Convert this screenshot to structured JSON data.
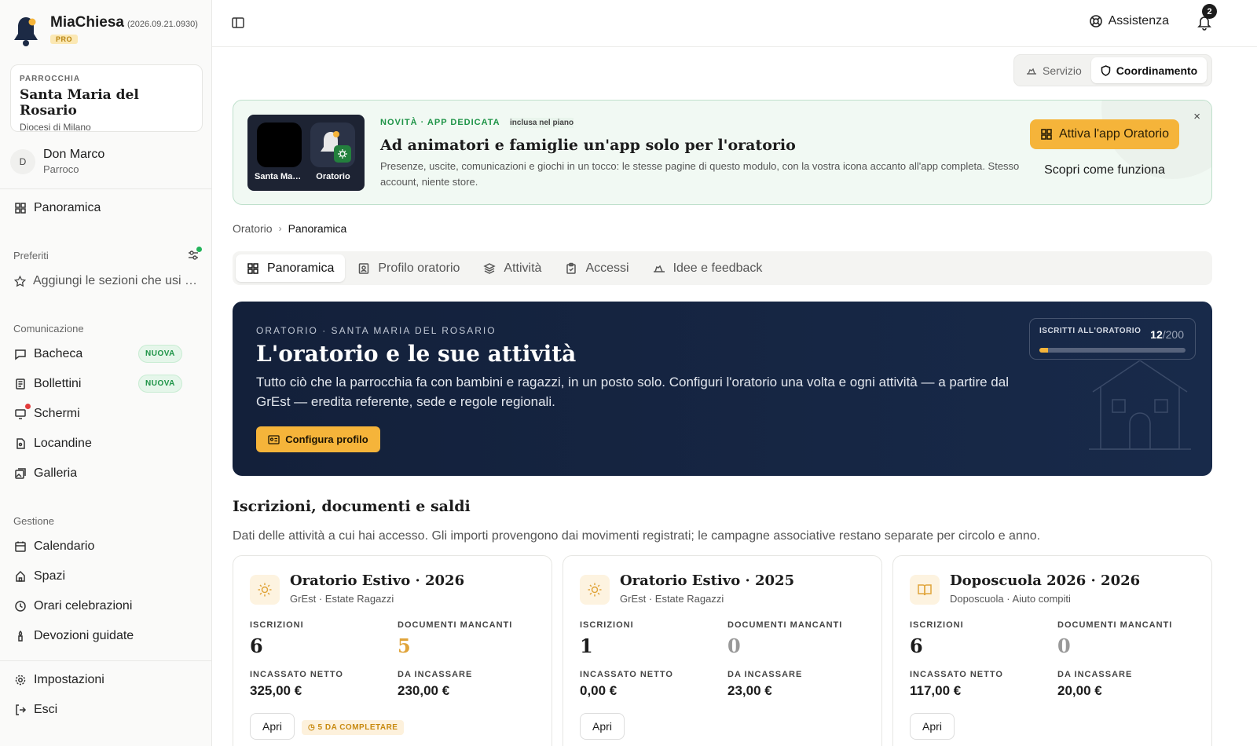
{
  "brand": {
    "name": "MiaChiesa",
    "version": "(2026.09.21.0930)",
    "plan": "PRO"
  },
  "parish": {
    "label": "PARROCCHIA",
    "name": "Santa Maria del Rosario",
    "diocese": "Diocesi di Milano"
  },
  "user": {
    "initial": "D",
    "name": "Don Marco",
    "role": "Parroco"
  },
  "sidebar": {
    "overview": "Panoramica",
    "favorites_title": "Preferiti",
    "favorites_hint": "Aggiungi le sezioni che usi più spesso",
    "communication_title": "Comunicazione",
    "communication": [
      {
        "label": "Bacheca",
        "badge": "NUOVA"
      },
      {
        "label": "Bollettini",
        "badge": "NUOVA"
      },
      {
        "label": "Schermi"
      },
      {
        "label": "Locandine"
      },
      {
        "label": "Galleria"
      }
    ],
    "management_title": "Gestione",
    "management": [
      {
        "label": "Calendario"
      },
      {
        "label": "Spazi"
      },
      {
        "label": "Orari celebrazioni"
      },
      {
        "label": "Devozioni guidate"
      }
    ],
    "settings": "Impostazioni",
    "logout": "Esci"
  },
  "topbar": {
    "help": "Assistenza",
    "notifications": "2"
  },
  "modes": {
    "service": "Servizio",
    "coordination": "Coordinamento"
  },
  "promo": {
    "tag": "NOVITÀ · APP DEDICATA",
    "included": "inclusa nel piano",
    "title": "Ad animatori e famiglie un'app solo per l'oratorio",
    "description": "Presenze, uscite, comunicazioni e giochi in un tocco: le stesse pagine di questo modulo, con la vostra icona accanto all'app completa. Stesso account, niente store.",
    "app1": "Santa Maria del Rosario",
    "app2": "Oratorio",
    "cta": "Attiva l'app Oratorio",
    "howto": "Scopri come funziona",
    "close": "×"
  },
  "breadcrumb": {
    "parent": "Oratorio",
    "current": "Panoramica"
  },
  "tabs": [
    "Panoramica",
    "Profilo oratorio",
    "Attività",
    "Accessi",
    "Idee e feedback"
  ],
  "hero": {
    "kicker": "ORATORIO · SANTA MARIA DEL ROSARIO",
    "title": "L'oratorio e le sue attività",
    "text": "Tutto ciò che la parrocchia fa con bambini e ragazzi, in un posto solo. Configuri l'oratorio una volta e ogni attività — a partire dal GrEst — eredita referente, sede e regole regionali.",
    "button": "Configura profilo",
    "enrolled_label": "ISCRITTI ALL'ORATORIO",
    "enrolled": "12",
    "capacity": "/200",
    "enrolled_fraction": 0.06
  },
  "section": {
    "title": "Iscrizioni, documenti e saldi",
    "description": "Dati delle attività a cui hai accesso. Gli importi provengono dai movimenti registrati; le campagne associative restano separate per circolo e anno."
  },
  "labels": {
    "enrollments": "ISCRIZIONI",
    "missing_docs": "DOCUMENTI MANCANTI",
    "net": "INCASSATO NETTO",
    "due": "DA INCASSARE",
    "open": "Apri"
  },
  "cards": [
    {
      "title": "Oratorio Estivo · 2026",
      "subtitle": "GrEst · Estate Ragazzi",
      "icon": "sun-icon",
      "enrollments": "6",
      "missing": "5",
      "net": "325,00 €",
      "due": "230,00 €",
      "warning": "5 DA COMPLETARE"
    },
    {
      "title": "Oratorio Estivo · 2025",
      "subtitle": "GrEst · Estate Ragazzi",
      "icon": "sun-icon",
      "enrollments": "1",
      "missing": "0",
      "net": "0,00 €",
      "due": "23,00 €"
    },
    {
      "title": "Doposcuola 2026 · 2026",
      "subtitle": "Doposcuola · Aiuto compiti",
      "icon": "book-icon",
      "enrollments": "6",
      "missing": "0",
      "net": "117,00 €",
      "due": "20,00 €"
    }
  ],
  "colors": {
    "accent": "#f5b43a",
    "hero_bg": "#13203a",
    "green": "#1e9447",
    "warn": "#e0a43a"
  }
}
